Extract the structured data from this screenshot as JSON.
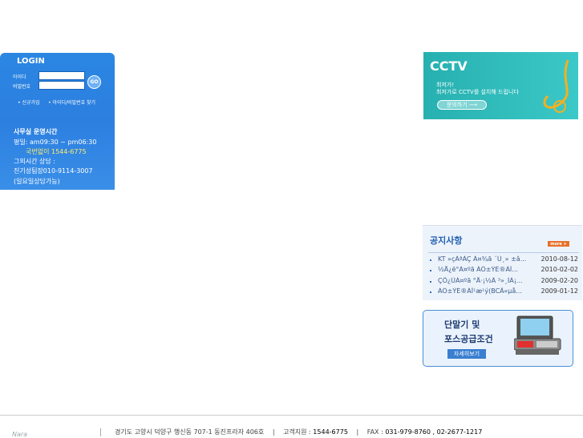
{
  "login": {
    "title": "LOGIN",
    "id_label": "아이디",
    "pw_label": "비밀번호",
    "go_label": "GO",
    "signup_link": "• 신규가입",
    "find_link": "• 아이디/비밀번호 찾기",
    "office_hours_title": "사무실 운영시간",
    "weekday_hours": "평일: am09:30 ~ pm06:30",
    "phone": "국번없이 1544-6775",
    "after_hours_title": "그외시간 상담 :",
    "after_hours_phone": "진기성팀장010-9114-3007",
    "sunday_note": "(일요일상담가능)"
  },
  "cctv_banner": {
    "title": "CCTV",
    "line1": "최저가!",
    "line2": "최저가로 CCTV를 설치해 드립니다",
    "button": "문의하기  ⟶"
  },
  "notice": {
    "title": "공지사항",
    "more_label": "more +",
    "items": [
      {
        "title": "KT »çÀªÀÇ Á¤¾ã ´Ù¸» ±â...",
        "date": "2010-08-12"
      },
      {
        "title": "½Å¿ë°Á¤ºã ÀÖ±ÝÈ®ÀÎ...",
        "date": "2010-02-02"
      },
      {
        "title": "ÇÕ¿ÜÀ¤ºã °Å·¡½Â ³»¸ÍÀ¡...",
        "date": "2009-02-20"
      },
      {
        "title": "ÀÖ±ÝÈ®ÀÎ¹æ¹ý(BCÄ«µå...",
        "date": "2009-01-12"
      }
    ]
  },
  "terminal_banner": {
    "line1": "단말기 및",
    "line2": "포스공급조건",
    "button": "자세히보기"
  },
  "footer": {
    "logo": "Nara",
    "address": "경기도 고양시 덕양구 행신동 707-1 동진프라자 406호",
    "support_label": "고객지원 :",
    "support_phone": "1544-6775",
    "fax_label": "FAX :",
    "fax_number": "031-979-8760 ,  02-2677-1217"
  }
}
